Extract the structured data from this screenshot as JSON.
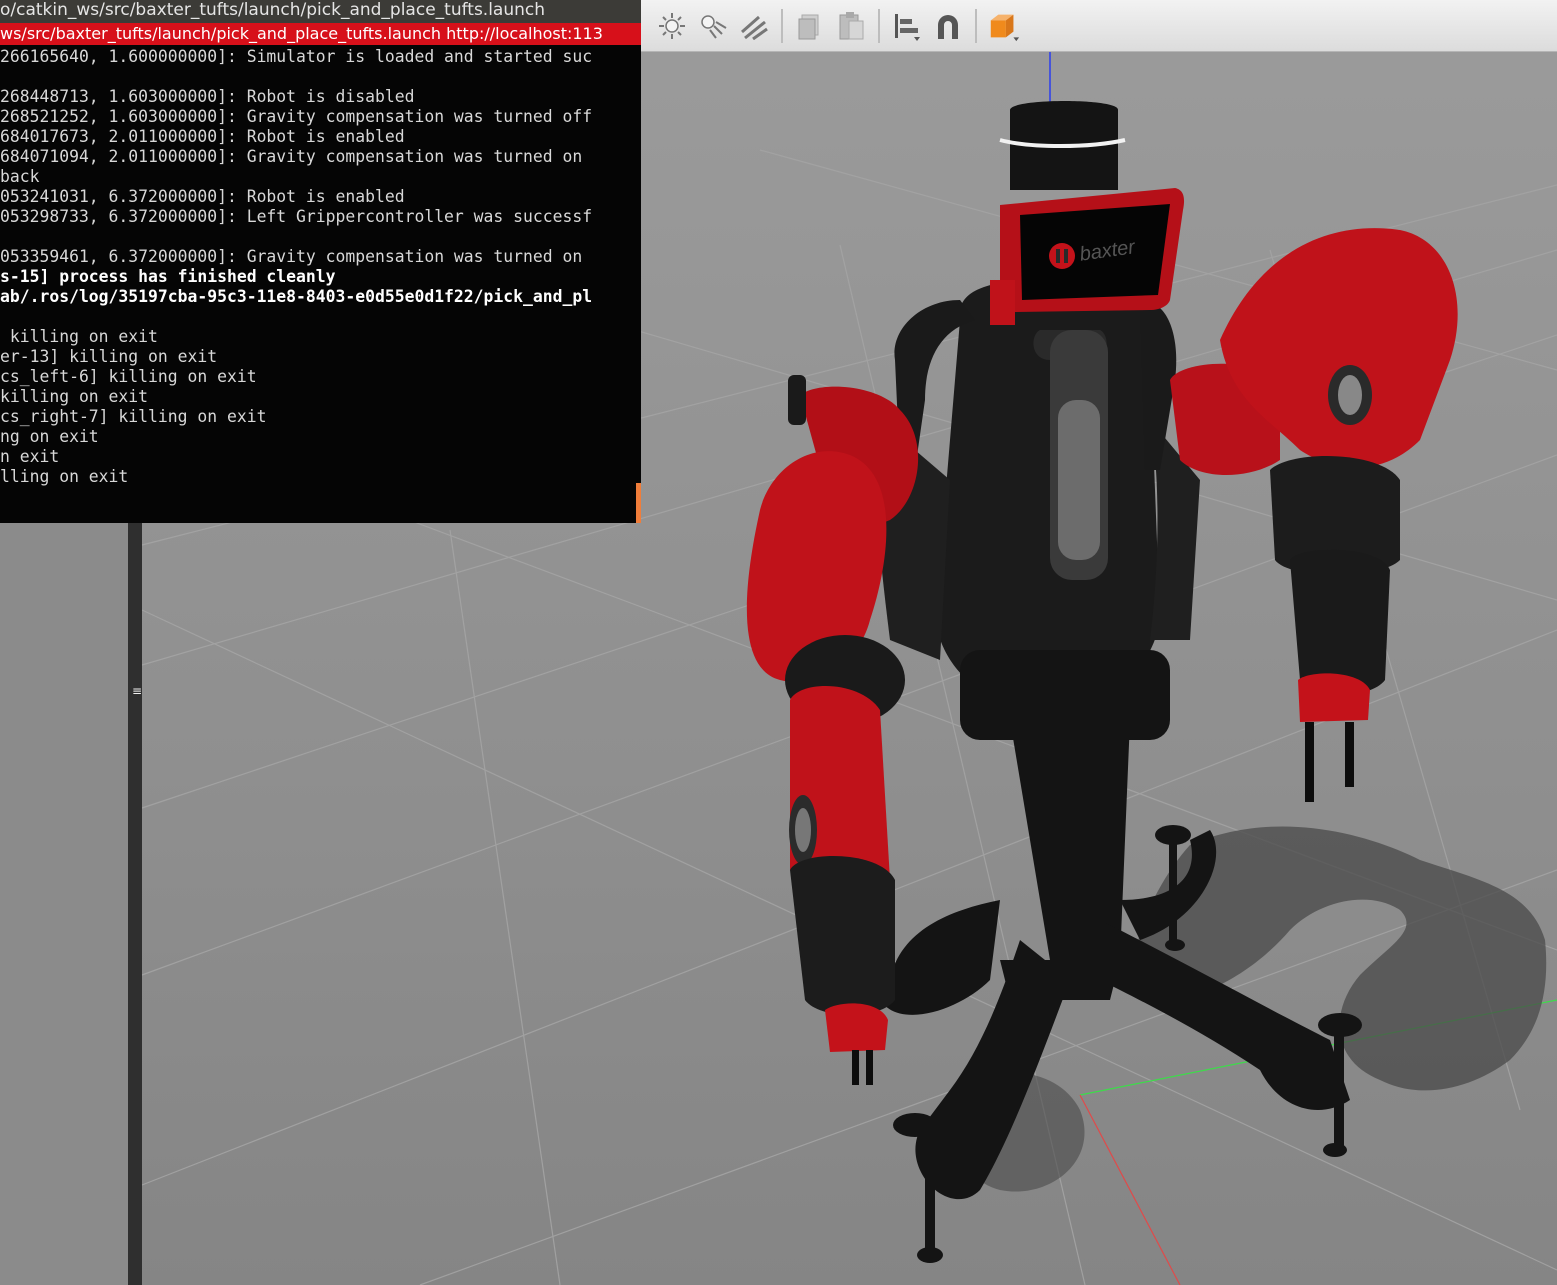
{
  "terminal": {
    "title": "o/catkin_ws/src/baxter_tufts/launch/pick_and_place_tufts.launch",
    "tab": "ws/src/baxter_tufts/launch/pick_and_place_tufts.launch http://localhost:113",
    "lines": [
      {
        "text": "266165640, 1.600000000]: Simulator is loaded and started suc",
        "bold": false
      },
      {
        "text": "",
        "bold": false
      },
      {
        "text": "268448713, 1.603000000]: Robot is disabled",
        "bold": false
      },
      {
        "text": "268521252, 1.603000000]: Gravity compensation was turned off",
        "bold": false
      },
      {
        "text": "684017673, 2.011000000]: Robot is enabled",
        "bold": false
      },
      {
        "text": "684071094, 2.011000000]: Gravity compensation was turned on",
        "bold": false
      },
      {
        "text": "back",
        "bold": false
      },
      {
        "text": "053241031, 6.372000000]: Robot is enabled",
        "bold": false
      },
      {
        "text": "053298733, 6.372000000]: Left Grippercontroller was successf",
        "bold": false
      },
      {
        "text": "",
        "bold": false
      },
      {
        "text": "053359461, 6.372000000]: Gravity compensation was turned on",
        "bold": false
      },
      {
        "text": "s-15] process has finished cleanly",
        "bold": true
      },
      {
        "text": "ab/.ros/log/35197cba-95c3-11e8-8403-e0d55e0d1f22/pick_and_pl",
        "bold": true
      },
      {
        "text": "",
        "bold": false
      },
      {
        "text": " killing on exit",
        "bold": false
      },
      {
        "text": "er-13] killing on exit",
        "bold": false
      },
      {
        "text": "cs_left-6] killing on exit",
        "bold": false
      },
      {
        "text": "killing on exit",
        "bold": false
      },
      {
        "text": "cs_right-7] killing on exit",
        "bold": false
      },
      {
        "text": "ng on exit",
        "bold": false
      },
      {
        "text": "n exit",
        "bold": false
      },
      {
        "text": "lling on exit",
        "bold": false
      }
    ]
  },
  "toolbar": {
    "items": [
      {
        "name": "directional-light-icon"
      },
      {
        "name": "spot-light-icon"
      },
      {
        "name": "sun-light-icon"
      },
      {
        "name": "copy-icon"
      },
      {
        "name": "paste-icon"
      },
      {
        "name": "align-icon"
      },
      {
        "name": "snap-magnet-icon"
      },
      {
        "name": "view-angle-cube-icon"
      }
    ]
  },
  "robot": {
    "brand_label": "baxter"
  },
  "colors": {
    "terminal_bg": "#050505",
    "terminal_tab": "#d7101a",
    "robot_red": "#c0121a",
    "robot_black": "#151515",
    "ground": "#8f8f8f"
  }
}
